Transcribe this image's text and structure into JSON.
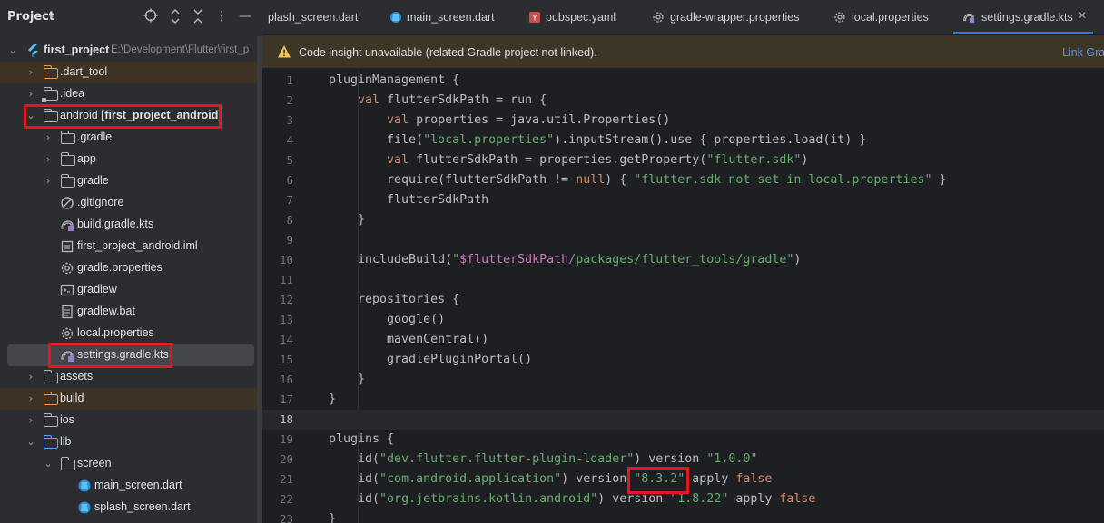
{
  "project_panel": {
    "title": "Project",
    "tree": [
      {
        "label": "first_project",
        "path": "E:\\Development\\Flutter\\first_p",
        "icon": "flutter-icon"
      },
      {
        "label": ".dart_tool",
        "icon": "folder-icon"
      },
      {
        "label": ".idea",
        "icon": "folder-icon"
      },
      {
        "label": "android",
        "module": "[first_project_android]",
        "icon": "folder-icon"
      },
      {
        "label": ".gradle",
        "icon": "folder-icon"
      },
      {
        "label": "app",
        "icon": "folder-icon"
      },
      {
        "label": "gradle",
        "icon": "folder-icon"
      },
      {
        "label": ".gitignore",
        "icon": "ignore-file-icon"
      },
      {
        "label": "build.gradle.kts",
        "icon": "gradle-icon"
      },
      {
        "label": "first_project_android.iml",
        "icon": "iml-file-icon"
      },
      {
        "label": "gradle.properties",
        "icon": "gear-icon"
      },
      {
        "label": "gradlew",
        "icon": "terminal-icon"
      },
      {
        "label": "gradlew.bat",
        "icon": "file-icon"
      },
      {
        "label": "local.properties",
        "icon": "gear-icon"
      },
      {
        "label": "settings.gradle.kts",
        "icon": "gradle-icon"
      },
      {
        "label": "assets",
        "icon": "folder-icon"
      },
      {
        "label": "build",
        "icon": "folder-icon"
      },
      {
        "label": "ios",
        "icon": "folder-icon"
      },
      {
        "label": "lib",
        "icon": "folder-icon"
      },
      {
        "label": "screen",
        "icon": "folder-icon"
      },
      {
        "label": "main_screen.dart",
        "icon": "dart-icon"
      },
      {
        "label": "splash_screen.dart",
        "icon": "dart-icon"
      }
    ]
  },
  "tabs": [
    {
      "label": "plash_screen.dart",
      "icon": "dart-icon"
    },
    {
      "label": "main_screen.dart",
      "icon": "dart-icon"
    },
    {
      "label": "pubspec.yaml",
      "icon": "yaml-icon"
    },
    {
      "label": "gradle-wrapper.properties",
      "icon": "gear-icon"
    },
    {
      "label": "local.properties",
      "icon": "gear-icon"
    },
    {
      "label": "settings.gradle.kts",
      "icon": "gradle-icon",
      "active": true
    }
  ],
  "banner": {
    "message": "Code insight unavailable (related Gradle project not linked).",
    "link": "Link Grac"
  },
  "code": {
    "current_line": "18",
    "lines": [
      {
        "n": "1",
        "text": "pluginManagement {"
      },
      {
        "n": "2",
        "text": "    val flutterSdkPath = run {"
      },
      {
        "n": "3",
        "text": "        val properties = java.util.Properties()"
      },
      {
        "n": "4",
        "text": "        file(\"local.properties\").inputStream().use { properties.load(it) }"
      },
      {
        "n": "5",
        "text": "        val flutterSdkPath = properties.getProperty(\"flutter.sdk\")"
      },
      {
        "n": "6",
        "text": "        require(flutterSdkPath != null) { \"flutter.sdk not set in local.properties\" }"
      },
      {
        "n": "7",
        "text": "        flutterSdkPath"
      },
      {
        "n": "8",
        "text": "    }"
      },
      {
        "n": "9",
        "text": ""
      },
      {
        "n": "10",
        "text": "    includeBuild(\"$flutterSdkPath/packages/flutter_tools/gradle\")"
      },
      {
        "n": "11",
        "text": ""
      },
      {
        "n": "12",
        "text": "    repositories {"
      },
      {
        "n": "13",
        "text": "        google()"
      },
      {
        "n": "14",
        "text": "        mavenCentral()"
      },
      {
        "n": "15",
        "text": "        gradlePluginPortal()"
      },
      {
        "n": "16",
        "text": "    }"
      },
      {
        "n": "17",
        "text": "}"
      },
      {
        "n": "18",
        "text": ""
      },
      {
        "n": "19",
        "text": "plugins {"
      },
      {
        "n": "20",
        "text": "    id(\"dev.flutter.flutter-plugin-loader\") version \"1.0.0\""
      },
      {
        "n": "21",
        "text": "    id(\"com.android.application\") version \"8.3.2\" apply false"
      },
      {
        "n": "22",
        "text": "    id(\"org.jetbrains.kotlin.android\") version \"1.8.22\" apply false"
      },
      {
        "n": "23",
        "text": "}"
      }
    ]
  },
  "colors": {
    "panel_bg": "#2b2d30",
    "editor_bg": "#1e1f22",
    "highlight_box": "#e5161d",
    "keyword": "#cf8e6d",
    "string": "#6aab73",
    "active_tab_underline": "#3574f0"
  }
}
